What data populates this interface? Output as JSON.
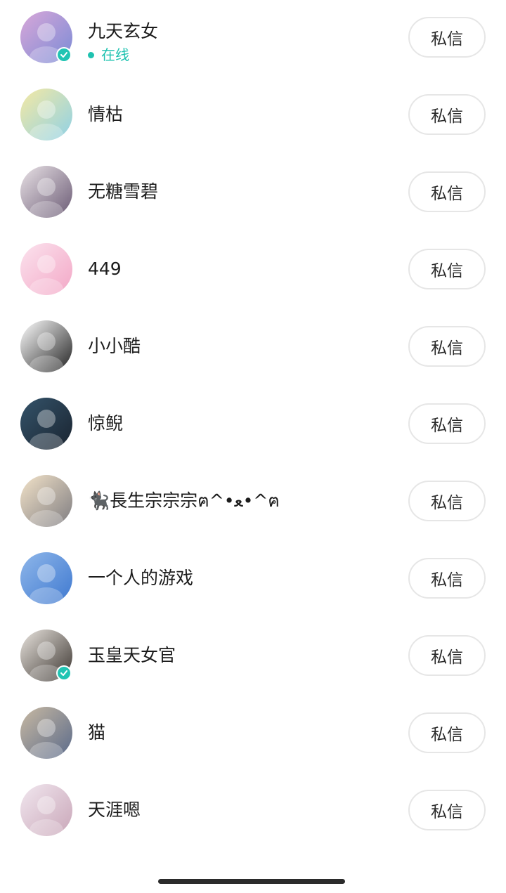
{
  "followers": [
    {
      "name": "九天玄女",
      "status": "在线",
      "verified": true,
      "avatar_colors": [
        "#d9a7d8",
        "#7a8bd6"
      ]
    },
    {
      "name": "情枯",
      "status": "",
      "verified": false,
      "avatar_colors": [
        "#f5e9a3",
        "#8fd1e6"
      ]
    },
    {
      "name": "无糖雪碧",
      "status": "",
      "verified": false,
      "avatar_colors": [
        "#e9e2e6",
        "#6a5a74"
      ]
    },
    {
      "name": "449",
      "status": "",
      "verified": false,
      "avatar_colors": [
        "#fbe3ee",
        "#f3a7c6"
      ]
    },
    {
      "name": "小小酷",
      "status": "",
      "verified": false,
      "avatar_colors": [
        "#ffffff",
        "#222222"
      ]
    },
    {
      "name": "惊鲵",
      "status": "",
      "verified": false,
      "avatar_colors": [
        "#34536a",
        "#1a2430"
      ]
    },
    {
      "name": "🐈‍⬛長生宗宗宗ฅ^•ﻌ•^ฅ",
      "status": "",
      "verified": false,
      "avatar_colors": [
        "#f3e3c9",
        "#7e7c80"
      ]
    },
    {
      "name": "一个人的游戏",
      "status": "",
      "verified": false,
      "avatar_colors": [
        "#8fb7ea",
        "#3f79d0"
      ]
    },
    {
      "name": "玉皇天女官",
      "status": "",
      "verified": true,
      "avatar_colors": [
        "#e9e4de",
        "#3b3530"
      ]
    },
    {
      "name": "猫",
      "status": "",
      "verified": false,
      "avatar_colors": [
        "#c8b9a2",
        "#5a6a8a"
      ]
    },
    {
      "name": "天涯嗯",
      "status": "",
      "verified": false,
      "avatar_colors": [
        "#f1e7ef",
        "#c9a6b8"
      ]
    }
  ],
  "dm_button_label": "私信",
  "accent_color": "#1fc2b0"
}
